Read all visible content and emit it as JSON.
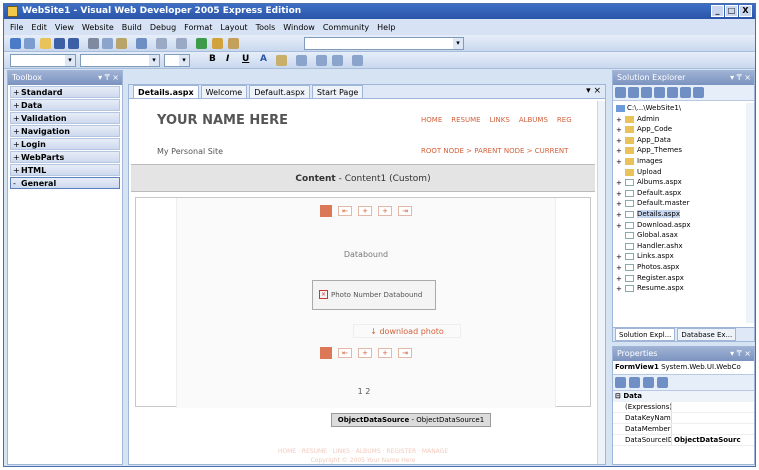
{
  "window": {
    "title": "WebSite1 - Visual Web Developer 2005 Express Edition",
    "controls": [
      "_",
      "□",
      "X"
    ]
  },
  "menu": [
    "File",
    "Edit",
    "View",
    "Website",
    "Build",
    "Debug",
    "Format",
    "Layout",
    "Tools",
    "Window",
    "Community",
    "Help"
  ],
  "format_toolbar": {
    "bold": "B",
    "italic": "I",
    "underline": "U",
    "font_color": "A"
  },
  "toolbox": {
    "title": "Toolbox",
    "groups": [
      {
        "label": "Standard",
        "pm": "+"
      },
      {
        "label": "Data",
        "pm": "+"
      },
      {
        "label": "Validation",
        "pm": "+"
      },
      {
        "label": "Navigation",
        "pm": "+"
      },
      {
        "label": "Login",
        "pm": "+"
      },
      {
        "label": "WebParts",
        "pm": "+"
      },
      {
        "label": "HTML",
        "pm": "+"
      },
      {
        "label": "General",
        "pm": "-"
      }
    ]
  },
  "doc_tabs": [
    "Details.aspx",
    "Welcome",
    "Default.aspx",
    "Start Page"
  ],
  "page": {
    "site_title": "YOUR NAME HERE",
    "nav": [
      "HOME",
      "RESUME",
      "LINKS",
      "ALBUMS",
      "REG"
    ],
    "personal": "My Personal Site",
    "sitemap": "ROOT NODE > PARENT NODE > CURRENT",
    "content_label": "Content",
    "content_name": "- Content1 (Custom)",
    "databound": "Databound",
    "photo_label": "Photo Number Databound",
    "download": "download photo",
    "page_numbers": "1 2",
    "ods_type": "ObjectDataSource",
    "ods_name": "- ObjectDataSource1",
    "footer_nav": "HOME · RESUME · LINKS · ALBUMS · REGISTER · MANAGE",
    "footer_copy": "Copyright © 2005 Your Name Here"
  },
  "solution_explorer": {
    "title": "Solution Explorer",
    "root": "C:\\...\\WebSite1\\",
    "items": [
      {
        "label": "Admin",
        "type": "folder",
        "exp": "+"
      },
      {
        "label": "App_Code",
        "type": "folder",
        "exp": "+"
      },
      {
        "label": "App_Data",
        "type": "folder",
        "exp": "+"
      },
      {
        "label": "App_Themes",
        "type": "folder",
        "exp": "+"
      },
      {
        "label": "Images",
        "type": "folder",
        "exp": "+"
      },
      {
        "label": "Upload",
        "type": "folder",
        "exp": ""
      },
      {
        "label": "Albums.aspx",
        "type": "file",
        "exp": "+"
      },
      {
        "label": "Default.aspx",
        "type": "file",
        "exp": "+"
      },
      {
        "label": "Default.master",
        "type": "file",
        "exp": "+"
      },
      {
        "label": "Details.aspx",
        "type": "file",
        "exp": "+",
        "selected": true
      },
      {
        "label": "Download.aspx",
        "type": "file",
        "exp": "+"
      },
      {
        "label": "Global.asax",
        "type": "file",
        "exp": ""
      },
      {
        "label": "Handler.ashx",
        "type": "file",
        "exp": ""
      },
      {
        "label": "Links.aspx",
        "type": "file",
        "exp": "+"
      },
      {
        "label": "Photos.aspx",
        "type": "file",
        "exp": "+"
      },
      {
        "label": "Register.aspx",
        "type": "file",
        "exp": "+"
      },
      {
        "label": "Resume.aspx",
        "type": "file",
        "exp": "+"
      }
    ],
    "tabs": [
      "Solution Expl...",
      "Database Ex..."
    ]
  },
  "properties": {
    "title": "Properties",
    "object": "FormView1",
    "object_type": "System.Web.UI.WebCo",
    "category": "Data",
    "rows": [
      {
        "name": "(Expressions)",
        "value": ""
      },
      {
        "name": "DataKeyName:",
        "value": ""
      },
      {
        "name": "DataMember",
        "value": ""
      },
      {
        "name": "DataSourceID",
        "value": "ObjectDataSourc"
      }
    ]
  }
}
